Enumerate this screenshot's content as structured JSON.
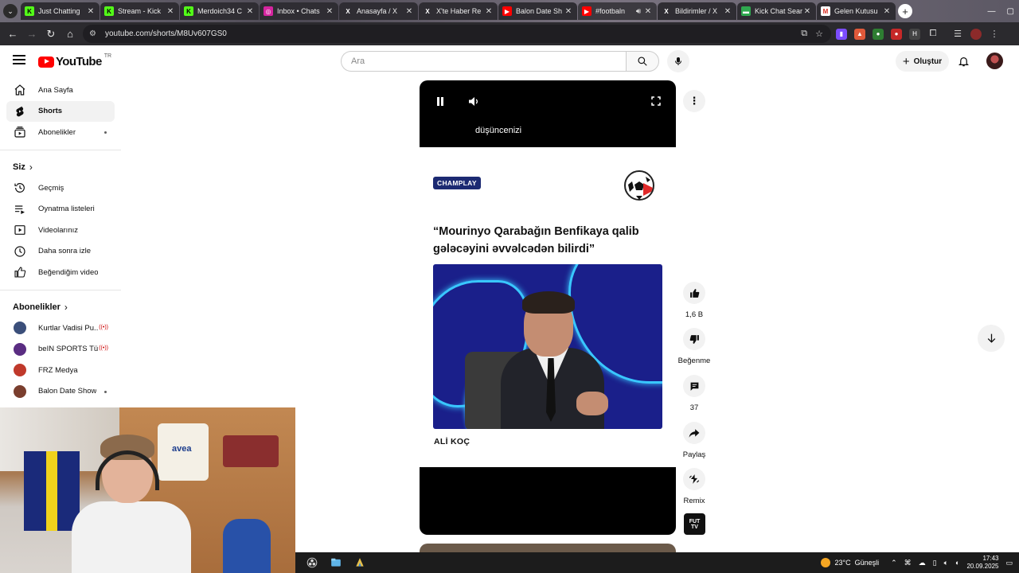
{
  "browser": {
    "tabs": [
      {
        "label": "Just Chatting",
        "fav": "K",
        "color": "#53fc18",
        "fg": "#000"
      },
      {
        "label": "Stream - Kick",
        "fav": "K",
        "color": "#53fc18",
        "fg": "#000"
      },
      {
        "label": "Merdoich34 C",
        "fav": "K",
        "color": "#53fc18",
        "fg": "#000"
      },
      {
        "label": "Inbox • Chats",
        "fav": "◎",
        "color": "#d6249f",
        "fg": "#fff"
      },
      {
        "label": "Anasayfa / X",
        "fav": "X",
        "color": "#2f2d33",
        "fg": "#fff"
      },
      {
        "label": "X'te Haber Re",
        "fav": "X",
        "color": "#2f2d33",
        "fg": "#fff"
      },
      {
        "label": "Balon Date Sh",
        "fav": "▶",
        "color": "#ff0000",
        "fg": "#fff"
      },
      {
        "label": "#footbaln",
        "fav": "▶",
        "color": "#ff0000",
        "fg": "#fff",
        "active": true
      },
      {
        "label": "Bildirimler / X",
        "fav": "X",
        "color": "#2f2d33",
        "fg": "#fff"
      },
      {
        "label": "Kick Chat Sear",
        "fav": "▬",
        "color": "#2fa84f",
        "fg": "#fff"
      },
      {
        "label": "Gelen Kutusu",
        "fav": "M",
        "color": "#ffffff",
        "fg": "#d93025"
      }
    ],
    "url": "youtube.com/shorts/M8Uv607GS0"
  },
  "masthead": {
    "logo_text": "YouTube",
    "country": "TR",
    "search_placeholder": "Ara",
    "create_label": "Oluştur"
  },
  "sidebar": {
    "main": [
      {
        "label": "Ana Sayfa",
        "icon": "home-icon"
      },
      {
        "label": "Shorts",
        "icon": "shorts-icon",
        "active": true
      },
      {
        "label": "Abonelikler",
        "icon": "subscriptions-icon",
        "dot": true
      }
    ],
    "you_heading": "Siz",
    "you": [
      {
        "label": "Geçmiş",
        "icon": "history-icon"
      },
      {
        "label": "Oynatma listeleri",
        "icon": "playlists-icon"
      },
      {
        "label": "Videolarınız",
        "icon": "your-videos-icon"
      },
      {
        "label": "Daha sonra izle",
        "icon": "watch-later-icon"
      },
      {
        "label": "Beğendiğim videolar",
        "icon": "liked-videos-icon"
      }
    ],
    "subs_heading": "Abonelikler",
    "subscriptions": [
      {
        "label": "Kurtlar Vadisi Pu...",
        "color": "#3b4f7a",
        "live": true
      },
      {
        "label": "beIN SPORTS Tü...",
        "color": "#5a2d82",
        "live": true
      },
      {
        "label": "FRZ Medya",
        "color": "#c0392b",
        "live": false
      },
      {
        "label": "Balon Date Show",
        "color": "#7a3e2e",
        "dot": true
      }
    ]
  },
  "short": {
    "caption": "düşüncenizi",
    "badge": "CHAMPLAY",
    "headline": "“Mourinyo Qarabağın Benfikaya qalib gələcəyini əvvəlcədən bilirdi”",
    "byline": "ALİ KOÇ",
    "likes": "1,6 B",
    "dislike_label": "Beğenme",
    "comments": "37",
    "share_label": "Paylaş",
    "remix_label": "Remix",
    "channel_logo": "FUT TV"
  },
  "taskbar": {
    "temperature": "23°C",
    "weather": "Güneşli",
    "time": "17:43",
    "date": "20.09.2025"
  }
}
